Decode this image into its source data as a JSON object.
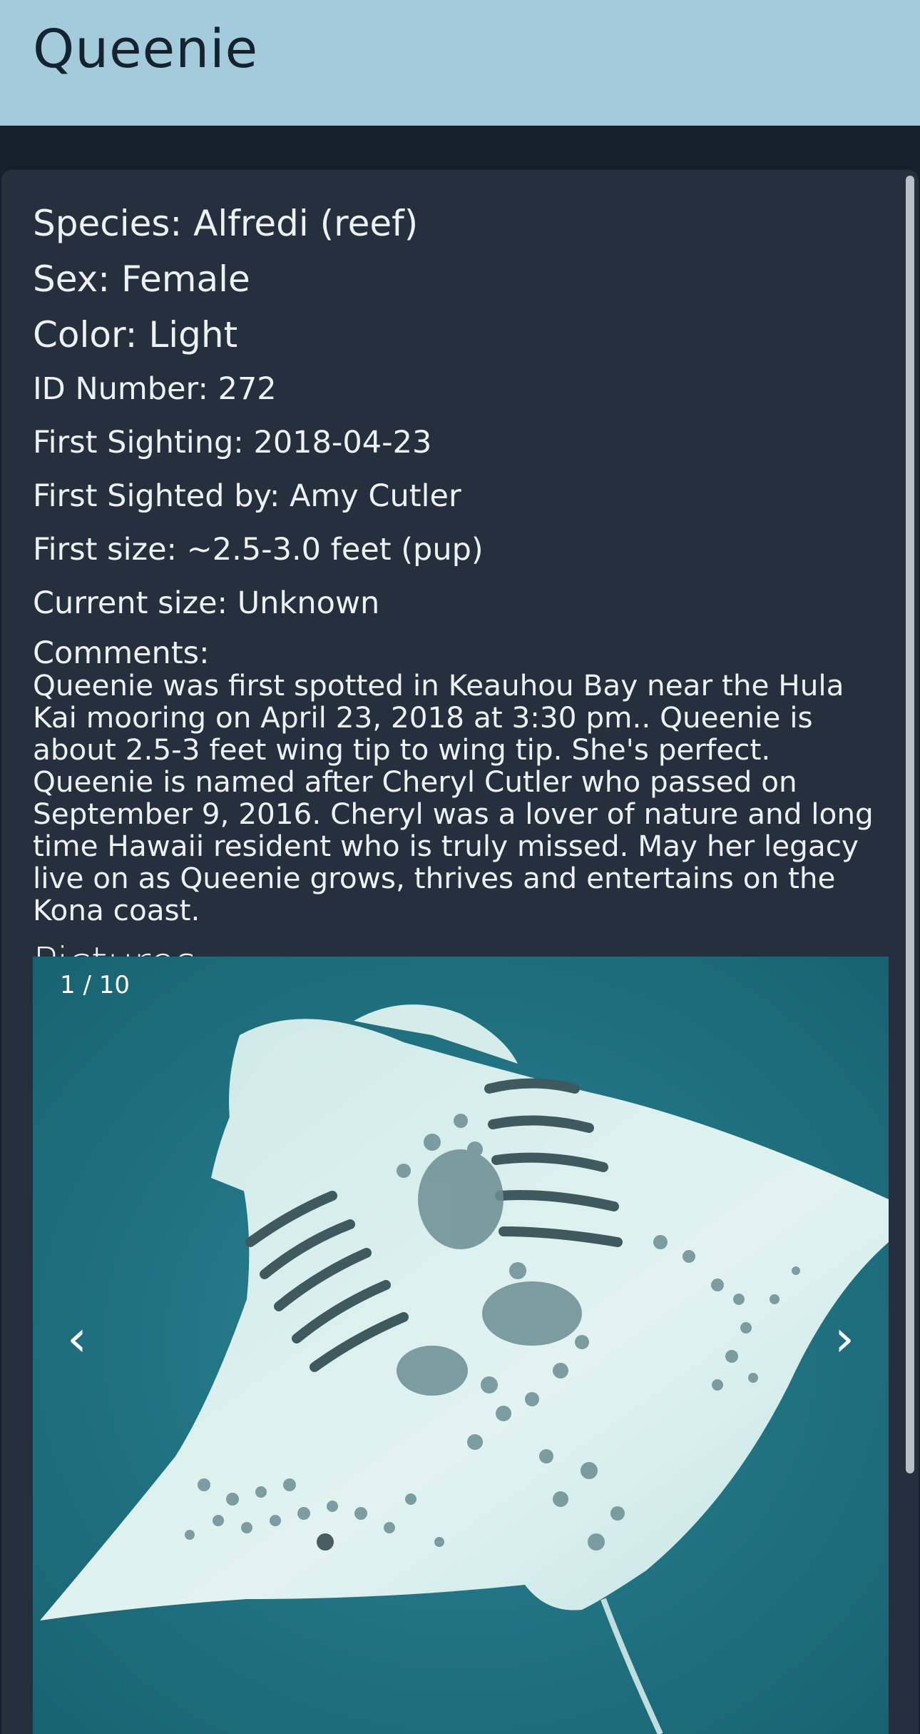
{
  "header": {
    "title": "Queenie"
  },
  "details": {
    "species": "Species: Alfredi (reef)",
    "sex": "Sex: Female",
    "color": "Color: Light",
    "id_number": "ID Number: 272",
    "first_sighting": "First Sighting: 2018-04-23",
    "first_sighted_by": "First Sighted by: Amy Cutler",
    "first_size": "First size: ~2.5-3.0 feet (pup)",
    "current_size": "Current size: Unknown"
  },
  "comments": {
    "label": "Comments:",
    "text": "Queenie was first spotted in Keauhou Bay near the Hula Kai mooring on April 23, 2018 at 3:30 pm.. Queenie is about 2.5-3 feet wing tip to wing tip. She's perfect. Queenie is named after Cheryl Cutler who passed on September 9, 2016. Cheryl was a lover of nature and long time Hawaii resident who is truly missed. May her legacy live on as Queenie grows, thrives and entertains on the Kona coast."
  },
  "pictures": {
    "title": "Pictures",
    "counter": "1 / 10",
    "prev_icon": "chevron-left-icon",
    "next_icon": "chevron-right-icon",
    "prev_glyph": "‹",
    "next_glyph": "›"
  },
  "colors": {
    "header_bg": "#a3cbdb",
    "page_bg": "#16202b",
    "card_bg": "#252f3e",
    "water": "#1e6f80",
    "manta_belly": "#dff0ee"
  }
}
